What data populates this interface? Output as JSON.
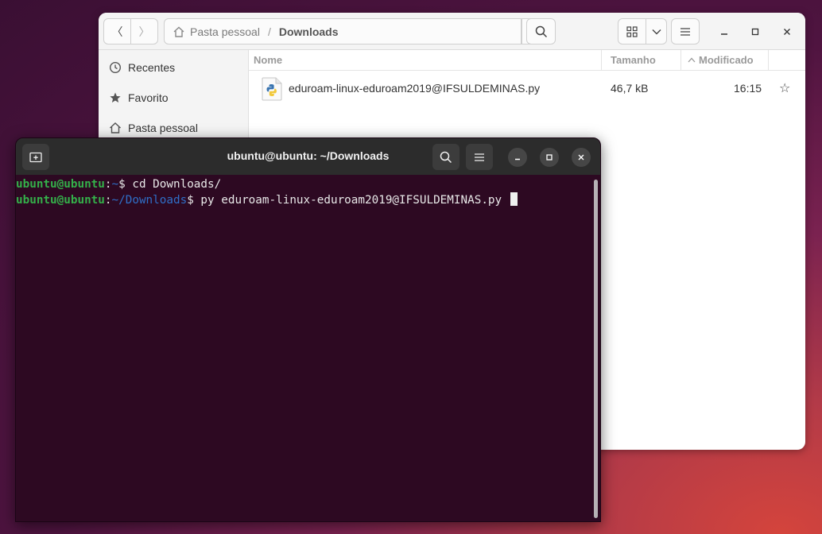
{
  "file_manager": {
    "path": {
      "home": "Pasta pessoal",
      "separator": "/",
      "current": "Downloads"
    },
    "sidebar": {
      "items": [
        {
          "label": "Recentes",
          "icon": "clock-icon"
        },
        {
          "label": "Favorito",
          "icon": "star-icon"
        },
        {
          "label": "Pasta pessoal",
          "icon": "home-icon"
        }
      ]
    },
    "columns": {
      "name": "Nome",
      "size": "Tamanho",
      "modified": "Modificado"
    },
    "files": [
      {
        "name": "eduroam-linux-eduroam2019@IFSULDEMINAS.py",
        "size": "46,7 kB",
        "modified": "16:15",
        "icon": "python-file-icon"
      }
    ]
  },
  "terminal": {
    "title": "ubuntu@ubuntu: ~/Downloads",
    "lines": [
      {
        "user": "ubuntu@ubuntu",
        "colon": ":",
        "path": "~",
        "prompt": "$",
        "command": " cd Downloads/"
      },
      {
        "user": "ubuntu@ubuntu",
        "colon": ":",
        "path": "~/Downloads",
        "prompt": "$",
        "command": " py eduroam-linux-eduroam2019@IFSULDEMINAS.py "
      }
    ]
  },
  "colors": {
    "prompt_user": "#34b04a",
    "prompt_path": "#2f6fc8",
    "terminal_bg": "#2d0922"
  }
}
